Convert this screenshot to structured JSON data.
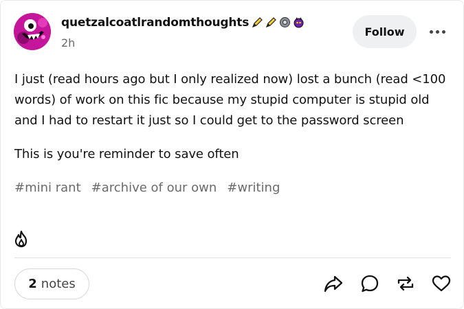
{
  "post": {
    "username": "quetzalcoatlrandomthoughts",
    "timestamp": "2h",
    "follow_label": "Follow",
    "badges": [
      "pencil-badge-icon",
      "pencil-badge-icon",
      "gear-badge-icon",
      "purple-monster-badge-icon"
    ],
    "avatar": "pink-monster-avatar",
    "body": [
      "I just  (read hours ago but I only realized now) lost a bunch (read <100 words) of work on this fic because my stupid computer is stupid old and I had to restart it just so I could get to the password screen",
      "This is you're reminder to save often"
    ],
    "tags": [
      "#mini rant",
      "#archive of our own",
      "#writing"
    ],
    "notes_count": "2",
    "notes_label": "notes"
  },
  "icons": {
    "blaze": "flame-icon",
    "share": "share-icon",
    "reply": "reply-icon",
    "reblog": "reblog-icon",
    "like": "heart-icon",
    "more": "more-options-icon"
  },
  "colors": {
    "text": "#121212",
    "muted": "#6a6a6a",
    "follow_bg": "#eff0f2",
    "avatar_bg": "#c5159b"
  }
}
